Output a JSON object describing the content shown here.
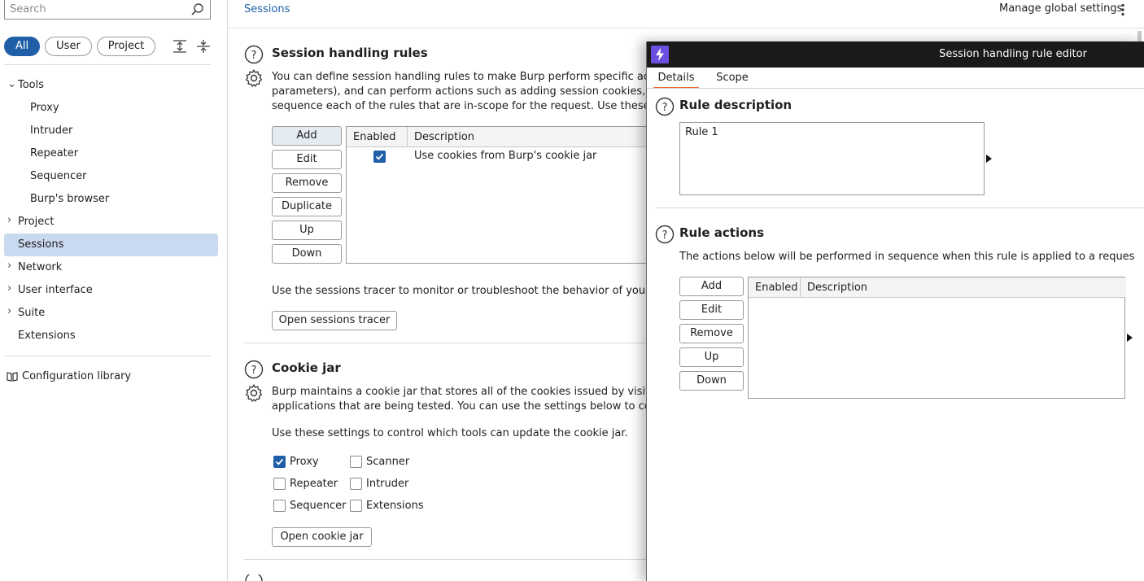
{
  "sidebar": {
    "search_placeholder": "Search",
    "filters": [
      "All",
      "User",
      "Project"
    ],
    "tree": {
      "tools": "Tools",
      "proxy": "Proxy",
      "intruder": "Intruder",
      "repeater": "Repeater",
      "sequencer": "Sequencer",
      "burps_browser": "Burp's browser",
      "project": "Project",
      "sessions": "Sessions",
      "network": "Network",
      "user_interface": "User interface",
      "suite": "Suite",
      "extensions": "Extensions"
    },
    "config_library": "Configuration library"
  },
  "header": {
    "breadcrumb": "Sessions",
    "manage_global": "Manage global settings"
  },
  "session_rules": {
    "title": "Session handling rules",
    "desc_line1": "You can define session handling rules to make Burp perform specific actions w",
    "desc_line2": "parameters), and can perform actions such as adding session cookies, logging",
    "desc_line3": "sequence each of the rules that are in-scope for the request. Use these setting",
    "buttons": {
      "add": "Add",
      "edit": "Edit",
      "remove": "Remove",
      "duplicate": "Duplicate",
      "up": "Up",
      "down": "Down"
    },
    "table": {
      "col_enabled": "Enabled",
      "col_description": "Description",
      "rows": [
        {
          "enabled": true,
          "description": "Use cookies from Burp's cookie jar"
        }
      ]
    },
    "tracer_text": "Use the sessions tracer to monitor or troubleshoot the behavior of your sessi",
    "open_tracer": "Open sessions tracer"
  },
  "cookie_jar": {
    "title": "Cookie jar",
    "desc_line1": "Burp maintains a cookie jar that stores all of the cookies issued by visited web",
    "desc_line2": "applications that are being tested. You can use the settings below to control h",
    "settings_text": "Use these settings to control which tools can update the cookie jar.",
    "options": {
      "proxy": {
        "label": "Proxy",
        "checked": true
      },
      "scanner": {
        "label": "Scanner",
        "checked": false
      },
      "repeater": {
        "label": "Repeater",
        "checked": false
      },
      "intruder": {
        "label": "Intruder",
        "checked": false
      },
      "sequencer": {
        "label": "Sequencer",
        "checked": false
      },
      "extensions": {
        "label": "Extensions",
        "checked": false
      }
    },
    "open_jar": "Open cookie jar"
  },
  "dialog": {
    "title": "Session handling rule editor",
    "tabs": [
      "Details",
      "Scope"
    ],
    "rule_description": {
      "title": "Rule description",
      "value": "Rule 1"
    },
    "rule_actions": {
      "title": "Rule actions",
      "text": "The actions below will be performed in sequence when this rule is applied to a request.",
      "buttons": {
        "add": "Add",
        "edit": "Edit",
        "remove": "Remove",
        "up": "Up",
        "down": "Down"
      },
      "col_enabled": "Enabled",
      "col_description": "Description"
    }
  },
  "colors": {
    "accent": "#1f5fa8",
    "selection": "#c9d9ef",
    "tab_underline": "#e8692b",
    "dialog_titlebar": "#1a1a1a",
    "logo": "#6b4fe0"
  }
}
